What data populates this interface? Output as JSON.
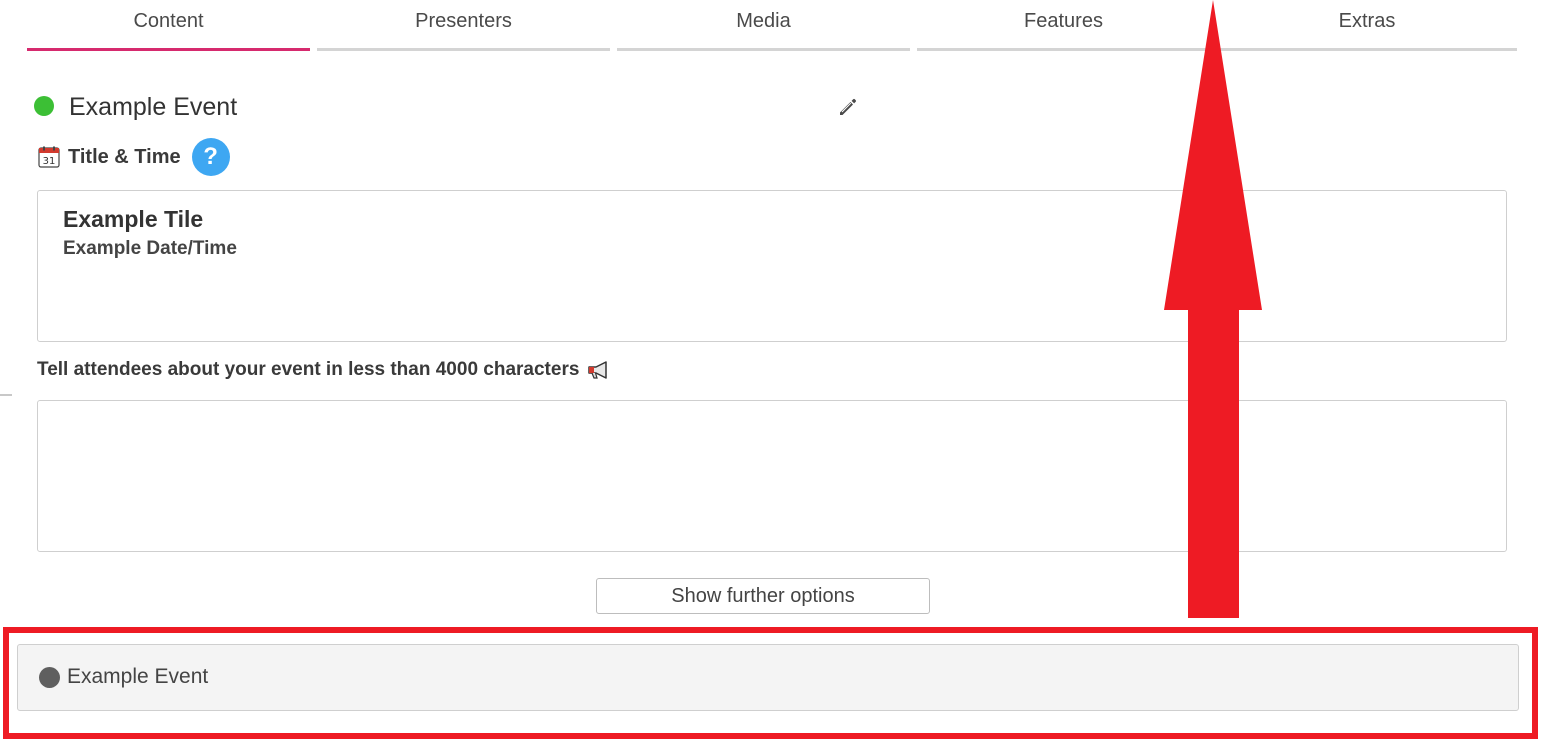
{
  "tabs": [
    {
      "label": "Content",
      "active": true
    },
    {
      "label": "Presenters",
      "active": false
    },
    {
      "label": "Media",
      "active": false
    },
    {
      "label": "Features",
      "active": false
    },
    {
      "label": "Extras",
      "active": false
    }
  ],
  "event": {
    "name": "Example Event",
    "status_color": "#3cbf35"
  },
  "title_time": {
    "label": "Title & Time",
    "icon": "calendar-icon",
    "help_label": "?",
    "tile_title": "Example Tile",
    "tile_datetime": "Example Date/Time"
  },
  "description": {
    "label": "Tell attendees about your event in less than 4000 characters",
    "icon": "megaphone-icon",
    "value": ""
  },
  "further_options_label": "Show further options",
  "bottom_bar": {
    "event_name": "Example Event",
    "status_color": "#5f5f5f"
  },
  "colors": {
    "accent": "#d62a6e",
    "help": "#3ea7f2",
    "highlight": "#ee1b24"
  }
}
